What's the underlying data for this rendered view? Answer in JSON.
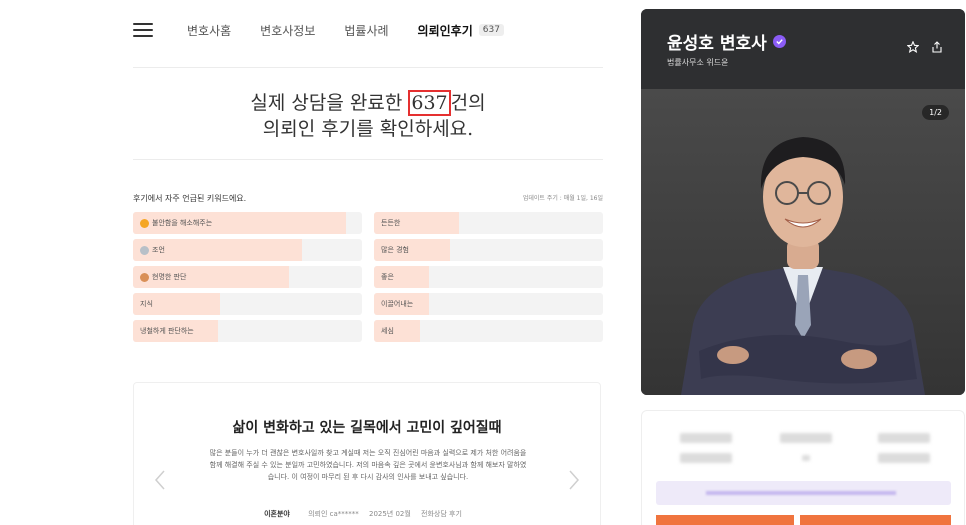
{
  "nav": {
    "items": [
      "변호사홈",
      "변호사정보",
      "법률사례"
    ],
    "active_label": "의뢰인후기",
    "active_count": "637"
  },
  "headline": {
    "line1_before": "실제 상담을 완료한 ",
    "count": "637",
    "line1_after": "건의",
    "line2": "의뢰인 후기를 확인하세요."
  },
  "keywords": {
    "title": "후기에서 자주 언급된 키워드에요.",
    "update_note": "업데이트 주기 : 매월 1일, 16일",
    "items": [
      {
        "label": "불안함을 해소해주는",
        "rank_icon": "gold-medal-icon",
        "fill": 0.93
      },
      {
        "label": "든든한",
        "rank_icon": "",
        "fill": 0.37
      },
      {
        "label": "조언",
        "rank_icon": "silver-medal-icon",
        "fill": 0.74
      },
      {
        "label": "많은 경험",
        "rank_icon": "",
        "fill": 0.33
      },
      {
        "label": "현명한 판단",
        "rank_icon": "bronze-medal-icon",
        "fill": 0.68
      },
      {
        "label": "좋은",
        "rank_icon": "",
        "fill": 0.24
      },
      {
        "label": "지식",
        "rank_icon": "",
        "fill": 0.38
      },
      {
        "label": "이끌어내는",
        "rank_icon": "",
        "fill": 0.24
      },
      {
        "label": "냉철하게 판단하는",
        "rank_icon": "",
        "fill": 0.37
      },
      {
        "label": "세심",
        "rank_icon": "",
        "fill": 0.2
      }
    ]
  },
  "review": {
    "title": "삶이 변화하고 있는 길목에서 고민이 깊어질때",
    "body": "많은 분들이 누가 더 괜찮은 변호사일까 찾고 계실때 저는 오직 진심어린 마음과 실력으로 제가 처한 어려움을 함께 해결해 주실 수 있는 분일까 고민하였습니다. 저의 마음속 깊은 곳에서 윤변호사님과 함께 해보자 말하였습니다. 이 여정이 마무리 된 후 다시 감사의 인사를 보내고 싶습니다.",
    "category": "이혼분야",
    "client": "의뢰인 ca******",
    "date": "2025년 02월",
    "type": "전화상담 후기"
  },
  "profile": {
    "name": "윤성호 변호사",
    "firm": "법률사무소 위드윤",
    "photo_counter": "1/2"
  },
  "colors": {
    "accent_fill": "#fde1d6",
    "verified": "#8b5cf6",
    "highlight_box": "#e53030",
    "cta": "#f0743e"
  }
}
